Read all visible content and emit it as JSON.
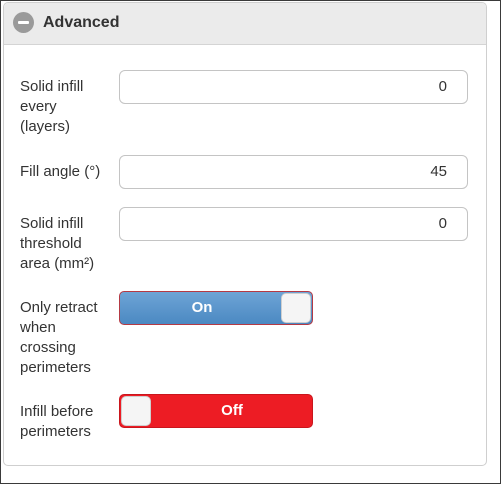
{
  "panel": {
    "title": "Advanced",
    "collapse_icon": "minus-circle-icon"
  },
  "fields": {
    "solid_infill_every": {
      "label": [
        "Solid infill",
        "every",
        "(layers)"
      ],
      "value": "0"
    },
    "fill_angle": {
      "label": [
        "Fill angle (°)"
      ],
      "value": "45"
    },
    "solid_infill_threshold": {
      "label": [
        "Solid infill",
        "threshold",
        "area (mm²)"
      ],
      "value": "0"
    }
  },
  "toggles": {
    "only_retract": {
      "label": [
        "Only retract",
        "when",
        "crossing",
        "perimeters"
      ],
      "state": "On"
    },
    "infill_before": {
      "label": [
        "Infill before",
        "perimeters"
      ],
      "state": "Off"
    }
  },
  "colors": {
    "toggle_on": "#4b89c2",
    "toggle_off": "#ed1c24"
  }
}
